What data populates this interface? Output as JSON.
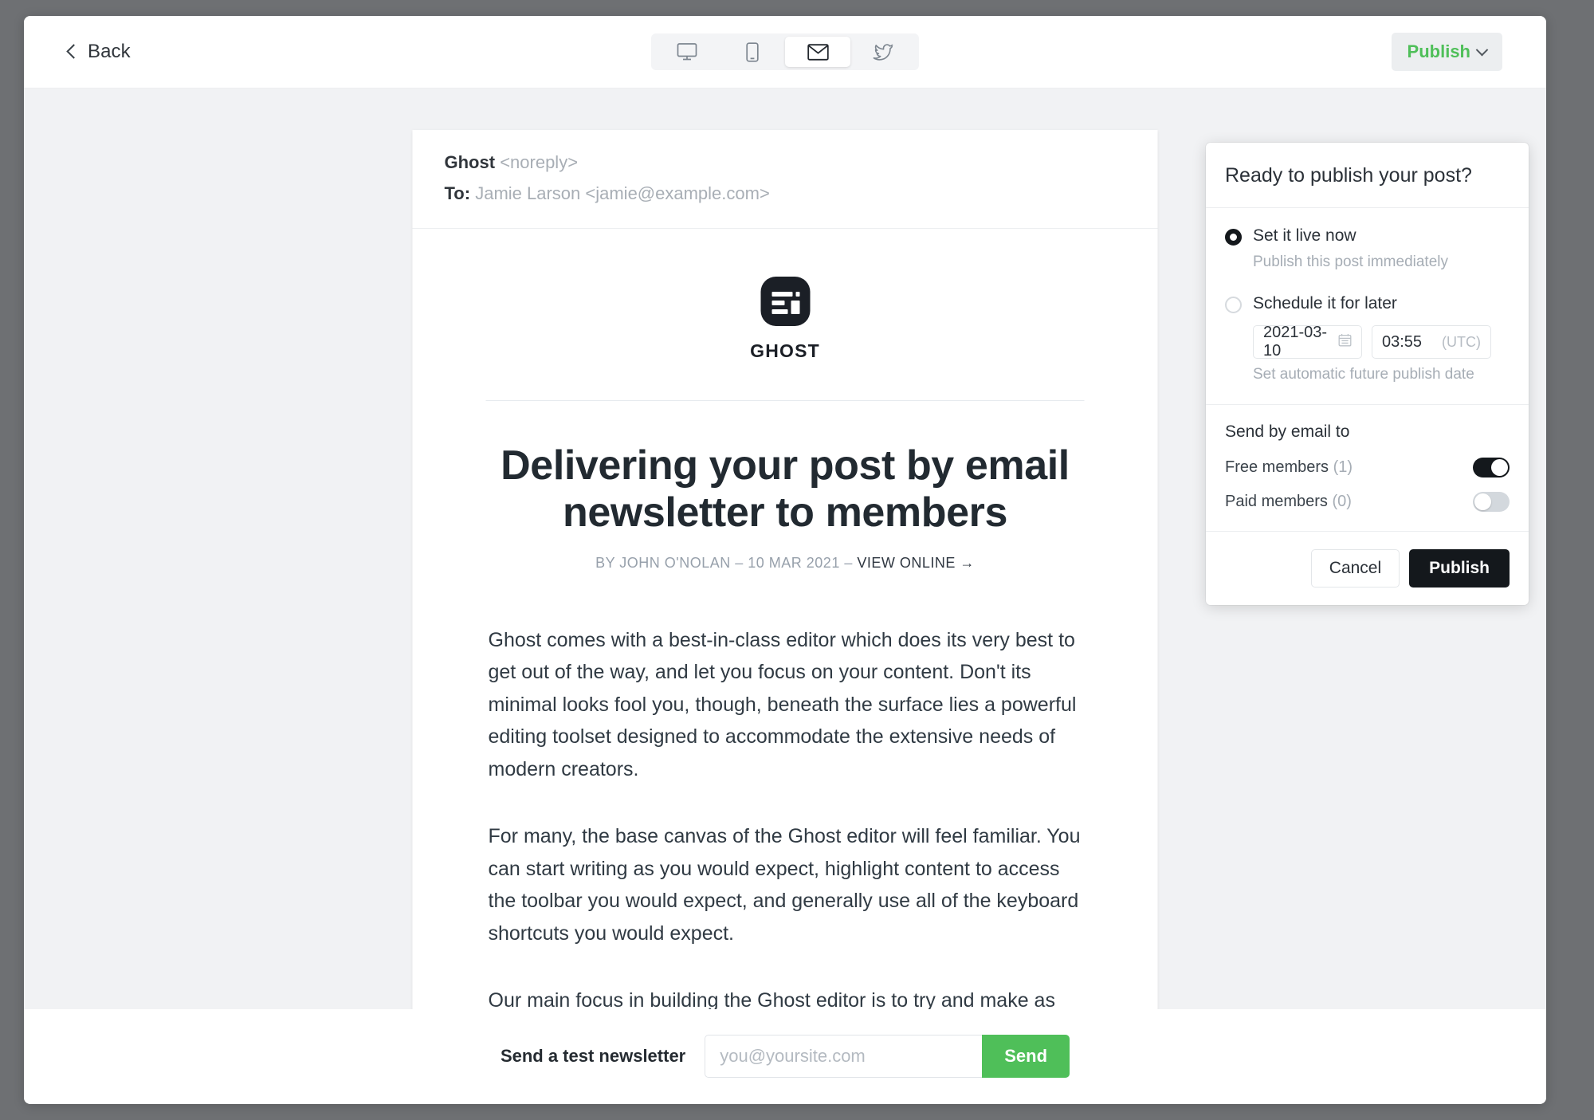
{
  "topbar": {
    "back_label": "Back",
    "publish_label": "Publish",
    "previews": [
      {
        "name": "desktop",
        "icon": "desktop-icon",
        "active": false
      },
      {
        "name": "mobile",
        "icon": "mobile-icon",
        "active": false
      },
      {
        "name": "email",
        "icon": "envelope-icon",
        "active": true
      },
      {
        "name": "twitter",
        "icon": "twitter-icon",
        "active": false
      }
    ]
  },
  "email": {
    "from_name": "Ghost",
    "from_address": "<noreply>",
    "to_label": "To:",
    "to_value": "Jamie Larson <jamie@example.com>",
    "brand_name": "GHOST",
    "title": "Delivering your post by email newsletter to members",
    "byline_prefix": "BY JOHN O'NOLAN – 10 MAR 2021 – ",
    "byline_link": "VIEW ONLINE →",
    "paragraphs": [
      "Ghost comes with a best-in-class editor which does its very best to get out of the way, and let you focus on your content. Don't its minimal looks fool you, though, beneath the surface lies a powerful editing toolset designed to accommodate the extensive needs of modern creators.",
      "For many, the base canvas of the Ghost editor will feel familiar. You can start writing as you would expect, highlight content to access the toolbar you would expect, and generally use all of the keyboard shortcuts you would expect.",
      "Our main focus in building the Ghost editor is to try and make as many things that you hope/expect might work: actually work."
    ]
  },
  "footer": {
    "test_label": "Send a test newsletter",
    "test_placeholder": "you@yoursite.com",
    "test_value": "",
    "send_label": "Send"
  },
  "publish_panel": {
    "heading": "Ready to publish your post?",
    "options": [
      {
        "title": "Set it live now",
        "subtitle": "Publish this post immediately",
        "selected": true
      },
      {
        "title": "Schedule it for later",
        "subtitle": "Set automatic future publish date",
        "selected": false
      }
    ],
    "schedule": {
      "date_value": "2021-03-10",
      "time_value": "03:55",
      "timezone": "(UTC)"
    },
    "email_section_title": "Send by email to",
    "members": [
      {
        "label": "Free members",
        "count": "(1)",
        "enabled": true
      },
      {
        "label": "Paid members",
        "count": "(0)",
        "enabled": false
      }
    ],
    "cancel_label": "Cancel",
    "publish_label": "Publish"
  },
  "colors": {
    "accent_green": "#4fbf59",
    "dark": "#14181c",
    "canvas_bg": "#f1f2f4",
    "backdrop": "#6e7073"
  }
}
